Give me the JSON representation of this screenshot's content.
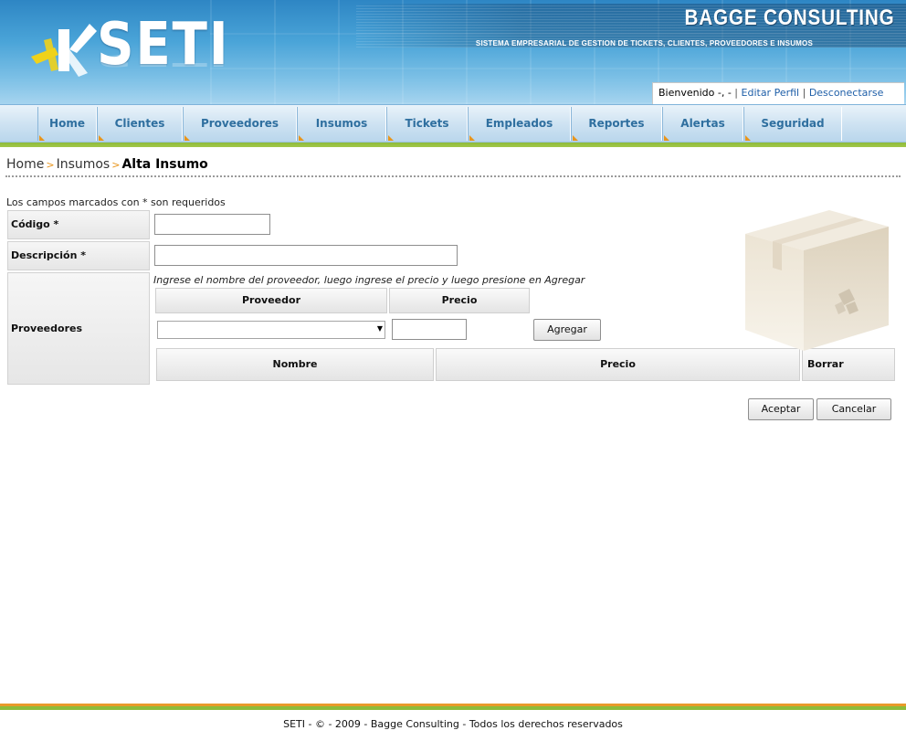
{
  "header": {
    "logo_text": "SETI",
    "brand": "BAGGE CONSULTING",
    "tagline": "SISTEMA EMPRESARIAL DE GESTION DE TICKETS, CLIENTES, PROVEEDORES E INSUMOS",
    "welcome": "Bienvenido -, -",
    "separator": "|",
    "edit_profile": "Editar Perfil",
    "logout": "Desconectarse"
  },
  "nav": {
    "items": [
      {
        "label": "Home"
      },
      {
        "label": "Clientes"
      },
      {
        "label": "Proveedores"
      },
      {
        "label": "Insumos"
      },
      {
        "label": "Tickets"
      },
      {
        "label": "Empleados"
      },
      {
        "label": "Reportes"
      },
      {
        "label": "Alertas"
      },
      {
        "label": "Seguridad"
      }
    ]
  },
  "breadcrumb": {
    "home": "Home",
    "arrow": ">",
    "section": "Insumos",
    "current": "Alta Insumo"
  },
  "form": {
    "required_note": "Los campos marcados con * son requeridos",
    "codigo_label": "Código *",
    "codigo_value": "",
    "descripcion_label": "Descripción *",
    "descripcion_value": "",
    "proveedores_label": "Proveedores",
    "hint": "Ingrese el nombre del proveedor, luego ingrese el precio y luego presione en Agregar",
    "col_proveedor": "Proveedor",
    "col_precio": "Precio",
    "proveedor_selected": "",
    "precio_value": "",
    "add_button": "Agregar",
    "list_col_nombre": "Nombre",
    "list_col_precio": "Precio",
    "list_col_borrar": "Borrar"
  },
  "actions": {
    "accept": "Aceptar",
    "cancel": "Cancelar"
  },
  "footer": {
    "text": "SETI - © - 2009 - Bagge Consulting - Todos los derechos reservados"
  },
  "colors": {
    "header_blue": "#3b95cf",
    "nav_text": "#2f6f9f",
    "accent_orange": "#e8951c",
    "accent_green": "#8dbb3a",
    "link": "#1f5fa8"
  },
  "icons": {
    "logo": "seti-k-logo-icon",
    "box": "package-box-icon",
    "dropdown": "chevron-down-icon"
  }
}
